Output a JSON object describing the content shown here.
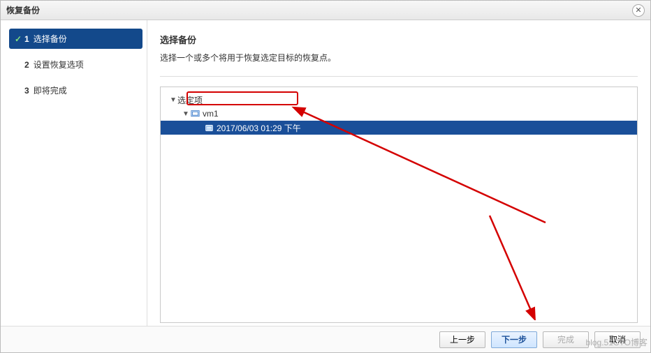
{
  "dialog": {
    "title": "恢复备份"
  },
  "steps": [
    {
      "num": "1",
      "label": "选择备份",
      "active": true,
      "checked": true
    },
    {
      "num": "2",
      "label": "设置恢复选项",
      "active": false,
      "checked": false
    },
    {
      "num": "3",
      "label": "即将完成",
      "active": false,
      "checked": false
    }
  ],
  "main": {
    "heading": "选择备份",
    "description": "选择一个或多个将用于恢复选定目标的恢复点。"
  },
  "tree": {
    "root_label": "选定项",
    "vm_label": "vm1",
    "backup_label": "2017/06/03 01:29 下午"
  },
  "buttons": {
    "back": "上一步",
    "next": "下一步",
    "finish": "完成",
    "cancel": "取消"
  },
  "watermark": "blog.51CTO博客"
}
